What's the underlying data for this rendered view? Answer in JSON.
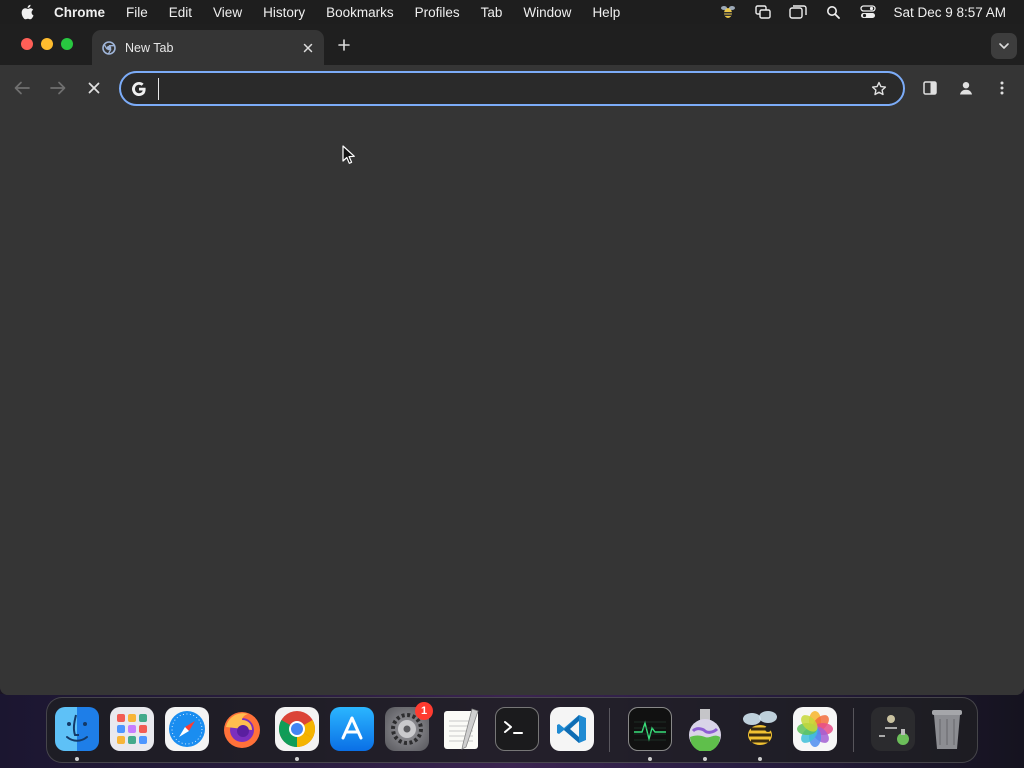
{
  "menubar": {
    "app_name": "Chrome",
    "items": [
      "File",
      "Edit",
      "View",
      "History",
      "Bookmarks",
      "Profiles",
      "Tab",
      "Window",
      "Help"
    ],
    "clock": "Sat Dec 9  8:57 AM"
  },
  "browser": {
    "tab_title": "New Tab",
    "omnibox_value": "",
    "accent_color": "#7cacf8",
    "window_bg": "#353535",
    "tabstrip_bg": "#1f1f1f"
  },
  "dock": {
    "apps": [
      {
        "name": "Finder",
        "icon": "finder-icon",
        "running": true
      },
      {
        "name": "Launchpad",
        "icon": "launchpad-icon",
        "running": false
      },
      {
        "name": "Safari",
        "icon": "safari-icon",
        "running": false
      },
      {
        "name": "Firefox",
        "icon": "firefox-icon",
        "running": false
      },
      {
        "name": "Chrome",
        "icon": "chrome-icon",
        "running": true
      },
      {
        "name": "App Store",
        "icon": "app-store-icon",
        "running": false
      },
      {
        "name": "System Settings",
        "icon": "system-settings-icon",
        "running": false,
        "badge": "1"
      },
      {
        "name": "TextEdit",
        "icon": "textedit-icon",
        "running": false
      },
      {
        "name": "Terminal",
        "icon": "terminal-icon",
        "running": false
      },
      {
        "name": "VS Code",
        "icon": "vscode-icon",
        "running": false
      },
      {
        "name": "Activity Monitor",
        "icon": "activity-monitor-icon",
        "running": true
      },
      {
        "name": "Script Editor",
        "icon": "flask-icon",
        "running": true
      },
      {
        "name": "Bee",
        "icon": "bee-icon",
        "running": true
      },
      {
        "name": "Photos",
        "icon": "photos-icon",
        "running": false
      },
      {
        "name": "Stacks",
        "icon": "stacks-icon",
        "running": false
      },
      {
        "name": "Trash",
        "icon": "trash-icon",
        "running": false
      }
    ]
  }
}
